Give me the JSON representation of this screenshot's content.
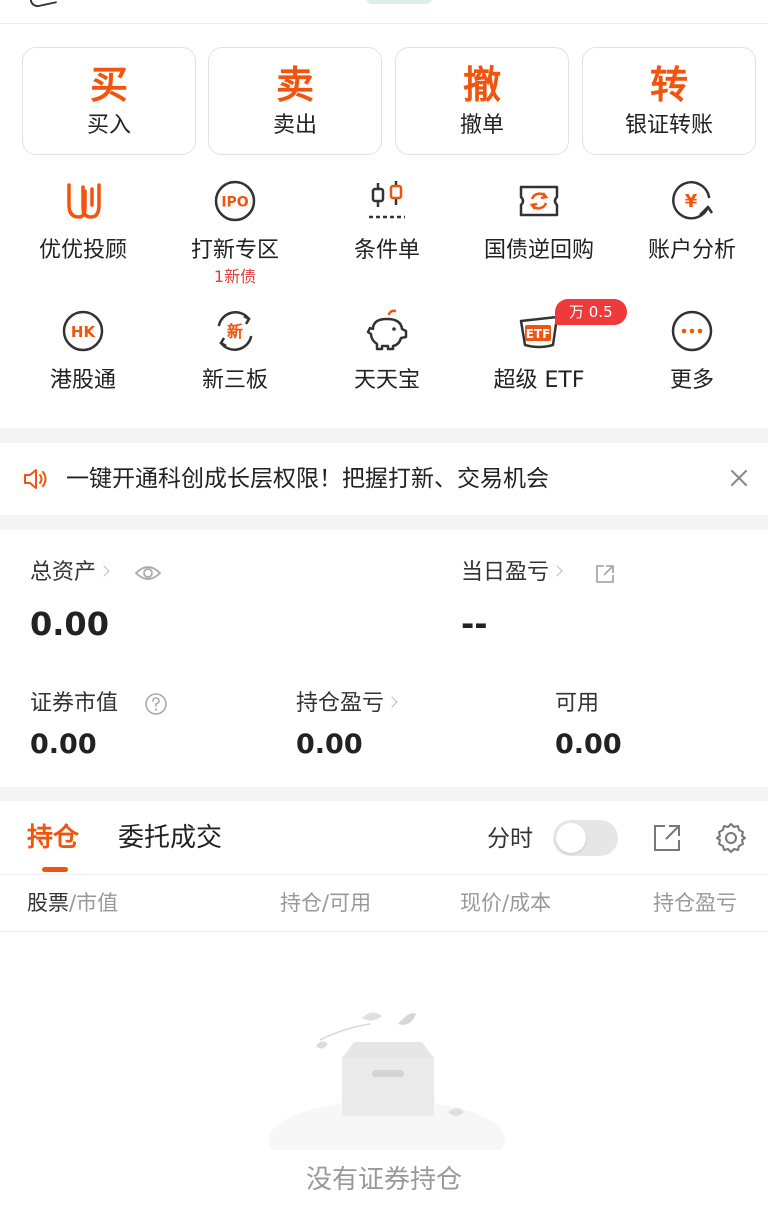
{
  "trade_buttons": [
    {
      "glyph": "买",
      "label": "买入"
    },
    {
      "glyph": "卖",
      "label": "卖出"
    },
    {
      "glyph": "撤",
      "label": "撤单"
    },
    {
      "glyph": "转",
      "label": "银证转账"
    }
  ],
  "features_row1": [
    {
      "label": "优优投顾",
      "icon": "uu-advisor-icon"
    },
    {
      "label": "打新专区",
      "icon": "ipo-icon",
      "icon_text": "IPO",
      "sub": "1新债"
    },
    {
      "label": "条件单",
      "icon": "condition-order-icon"
    },
    {
      "label": "国债逆回购",
      "icon": "reverse-repo-icon"
    },
    {
      "label": "账户分析",
      "icon": "account-analysis-icon",
      "icon_text": "¥"
    }
  ],
  "features_row2": [
    {
      "label": "港股通",
      "icon": "hk-connect-icon",
      "icon_text": "HK"
    },
    {
      "label": "新三板",
      "icon": "neeq-icon",
      "icon_text": "新"
    },
    {
      "label": "天天宝",
      "icon": "piggy-bank-icon"
    },
    {
      "label": "超级 ETF",
      "icon": "etf-icon",
      "icon_text": "ETF",
      "badge": "万 0.5"
    },
    {
      "label": "更多",
      "icon": "more-icon"
    }
  ],
  "notice": {
    "text": "一键开通科创成长层权限！把握打新、交易机会",
    "icon": "speaker-icon"
  },
  "assets": {
    "total_label": "总资产",
    "total_value": "0.00",
    "daily_pl_label": "当日盈亏",
    "daily_pl_value": "--",
    "market_value_label": "证券市值",
    "market_value": "0.00",
    "position_pl_label": "持仓盈亏",
    "position_pl_value": "0.00",
    "available_label": "可用",
    "available_value": "0.00"
  },
  "tabs": {
    "holdings": "持仓",
    "orders": "委托成交",
    "intraday_label": "分时",
    "intraday_on": false
  },
  "columns": [
    {
      "main": "股票",
      "sub": "/市值"
    },
    {
      "main": "持仓",
      "sub": "/可用"
    },
    {
      "main": "现价",
      "sub": "/成本"
    },
    {
      "main": "持仓盈亏",
      "sub": ""
    }
  ],
  "empty_state": {
    "text": "没有证券持仓"
  },
  "colors": {
    "accent": "#f0540e",
    "badge": "#ee3a3a",
    "divider": "#f4f4f6"
  }
}
